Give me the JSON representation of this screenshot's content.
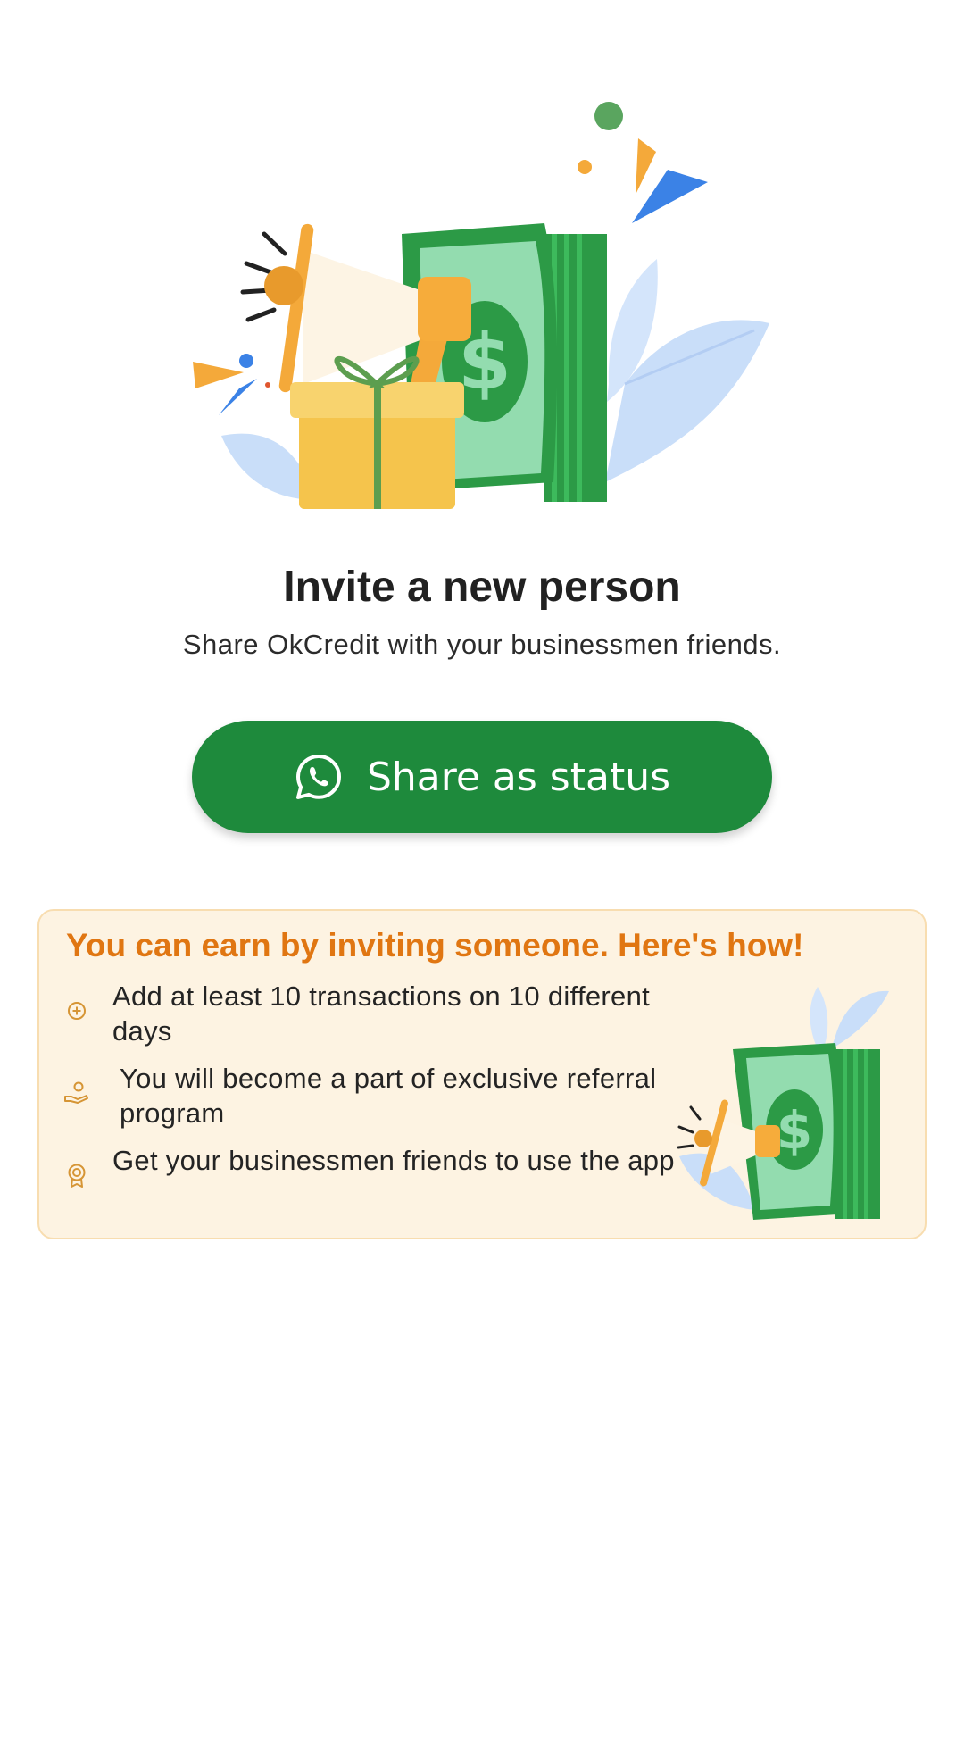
{
  "invite": {
    "title": "Invite a new person",
    "subtitle": "Share OkCredit with your businessmen friends."
  },
  "share_button": {
    "icon": "whatsapp-icon",
    "label": "Share as status",
    "color": "#1e8a3c"
  },
  "earn_card": {
    "title": "You can earn by inviting someone. Here's how!",
    "title_color": "#e07612",
    "background": "#fdf3e2",
    "steps": [
      {
        "icon": "plus-circle-icon",
        "text": "Add at least 10 transactions on 10 different days"
      },
      {
        "icon": "hand-coin-icon",
        "text": "You will become a part of exclusive referral program"
      },
      {
        "icon": "badge-icon",
        "text": "Get your businessmen friends to use the app"
      }
    ]
  }
}
